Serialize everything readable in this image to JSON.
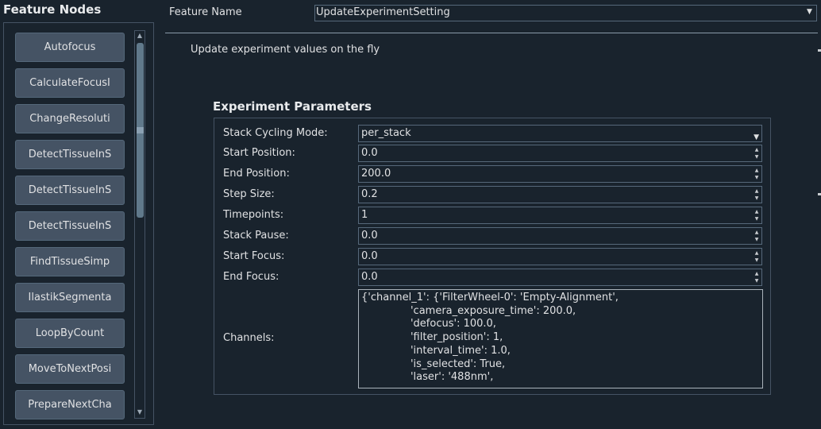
{
  "left_panel": {
    "title": "Feature Nodes",
    "nodes": [
      {
        "label": "Autofocus"
      },
      {
        "label": "CalculateFocusI"
      },
      {
        "label": "ChangeResoluti"
      },
      {
        "label": "DetectTissueInS"
      },
      {
        "label": "DetectTissueInS"
      },
      {
        "label": "DetectTissueInS"
      },
      {
        "label": "FindTissueSimp"
      },
      {
        "label": "IlastikSegmenta"
      },
      {
        "label": "LoopByCount"
      },
      {
        "label": "MoveToNextPosi"
      },
      {
        "label": "PrepareNextCha"
      }
    ]
  },
  "feature": {
    "label": "Feature Name",
    "selected": "UpdateExperimentSetting",
    "description": "Update experiment values on the fly"
  },
  "params": {
    "title": "Experiment Parameters",
    "fields": [
      {
        "label": "Stack Cycling Mode:",
        "value": "per_stack",
        "kind": "dropdown"
      },
      {
        "label": "Start Position:",
        "value": "0.0",
        "kind": "spin"
      },
      {
        "label": "End Position:",
        "value": "200.0",
        "kind": "spin"
      },
      {
        "label": "Step Size:",
        "value": "0.2",
        "kind": "spin"
      },
      {
        "label": "Timepoints:",
        "value": "1",
        "kind": "spin"
      },
      {
        "label": "Stack Pause:",
        "value": "0.0",
        "kind": "spin"
      },
      {
        "label": "Start Focus:",
        "value": "0.0",
        "kind": "spin"
      },
      {
        "label": "End Focus:",
        "value": "0.0",
        "kind": "spin"
      }
    ],
    "channels_label": "Channels:",
    "channels_text": "{'channel_1': {'FilterWheel-0': 'Empty-Alignment',\n               'camera_exposure_time': 200.0,\n               'defocus': 100.0,\n               'filter_position': 1,\n               'interval_time': 1.0,\n               'is_selected': True,\n               'laser': '488nm',"
  },
  "icons": {
    "dropdown_arrow": "chevron-down-icon",
    "spin_arrows": "spin-up-down-icon",
    "scroll_up": "triangle-up-icon",
    "scroll_down": "triangle-down-icon"
  },
  "colors": {
    "background": "#19232d",
    "button": "#455364",
    "border": "#56687a"
  }
}
